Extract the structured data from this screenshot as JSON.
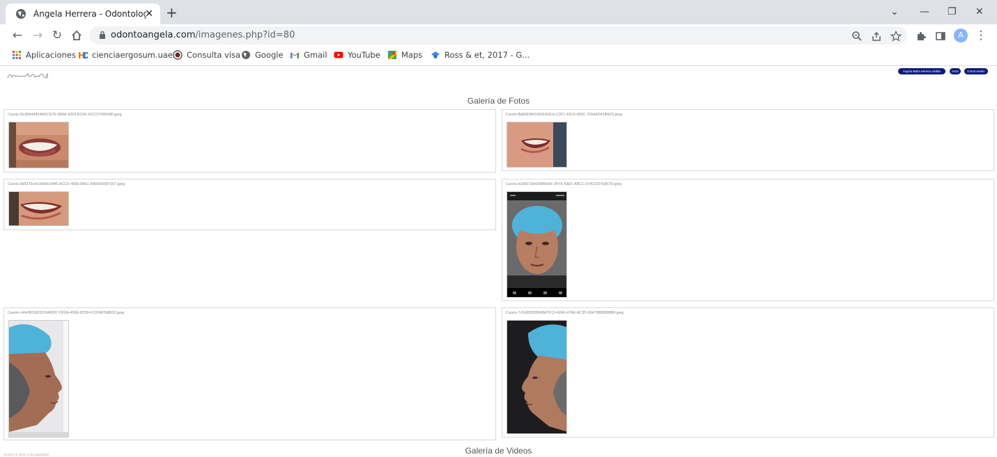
{
  "browser": {
    "tab_title": "Ángela Herrera - Odontology &",
    "url_host": "odontoangela.com",
    "url_path": "/imagenes.php?id=80",
    "avatar_letter": "A"
  },
  "bookmarks": [
    {
      "label": "Aplicaciones",
      "icon": "apps-grid-icon"
    },
    {
      "label": "cienciaergosum.uae...",
      "icon": "hd-icon"
    },
    {
      "label": "Consulta visa",
      "icon": "seal-icon"
    },
    {
      "label": "Google",
      "icon": "globe-icon"
    },
    {
      "label": "Gmail",
      "icon": "gmail-icon"
    },
    {
      "label": "YouTube",
      "icon": "youtube-icon"
    },
    {
      "label": "Maps",
      "icon": "maps-icon"
    },
    {
      "label": "Ross & et, 2017 - G...",
      "icon": "scholar-icon"
    }
  ],
  "header": {
    "user_label": "Ángela María Herrera Arellán",
    "home_label": "Inicio",
    "logout_label": "Cerrar sesión"
  },
  "gallery": {
    "photos_title": "Galería de Fotos",
    "photos": [
      {
        "filename": "Canris-f3c30b44ff2AA6CD76-3B9A-4263-B234-16CC5768358F.jpeg"
      },
      {
        "filename": "Canris-ffa6683841683FE0Cd-C2F1-40C0-993C-7684AD41B5D3.jpeg"
      },
      {
        "filename": "Canris-9d8373cdc0999b29f46-ACC6-4568-986C-A9D665687307.jpeg"
      },
      {
        "filename": "Canris-d100073b4298f0e0F-3FF6-43EF-ABCC-07AC0D76A57D.jpeg"
      },
      {
        "filename": "Canris-c44cf90180315946097-DF0A-456E-8238-FC0248768B32.jpeg"
      },
      {
        "filename": "Canris-7c5432f39594BA7F13-42A0-47A6-AC3D-69479BBBBBBF.jpeg"
      }
    ],
    "videos_title": "Galería de Videos",
    "no_videos_text": "Usuario no tiene video guardado"
  },
  "colors": {
    "pill_bg": "#0d1a7a",
    "cap_blue": "#4fb3d9"
  }
}
